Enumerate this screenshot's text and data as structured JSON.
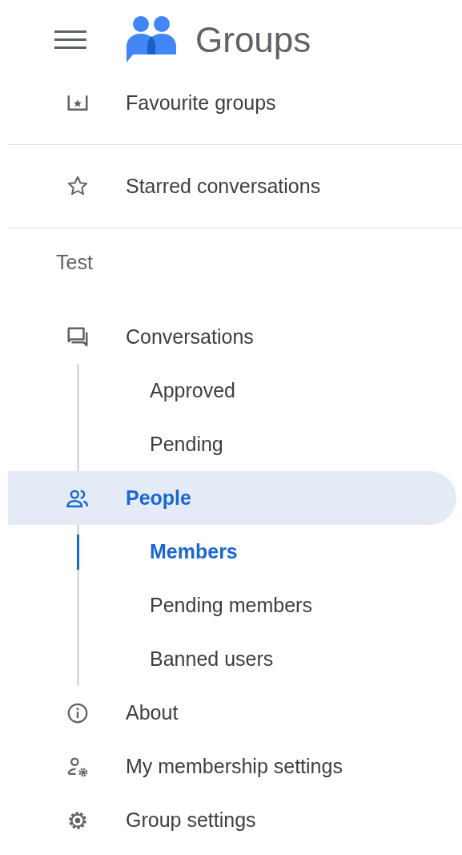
{
  "header": {
    "title": "Groups"
  },
  "sections": [
    {
      "items": [
        {
          "kind": "favourites",
          "label": "Favourite groups",
          "selected": false
        }
      ]
    },
    {
      "items": [
        {
          "kind": "starred",
          "label": "Starred conversations",
          "selected": false
        }
      ]
    },
    {
      "title": "Test",
      "items": [
        {
          "kind": "conversations",
          "label": "Conversations",
          "selected": false,
          "children": [
            {
              "label": "Approved",
              "selected": false
            },
            {
              "label": "Pending",
              "selected": false
            }
          ]
        },
        {
          "kind": "people",
          "label": "People",
          "selected": true,
          "children": [
            {
              "label": "Members",
              "selected": true
            },
            {
              "label": "Pending members",
              "selected": false
            },
            {
              "label": "Banned users",
              "selected": false
            }
          ]
        },
        {
          "kind": "about",
          "label": "About",
          "selected": false
        },
        {
          "kind": "membership",
          "label": "My membership settings",
          "selected": false
        },
        {
          "kind": "settings",
          "label": "Group settings",
          "selected": false
        }
      ]
    }
  ]
}
